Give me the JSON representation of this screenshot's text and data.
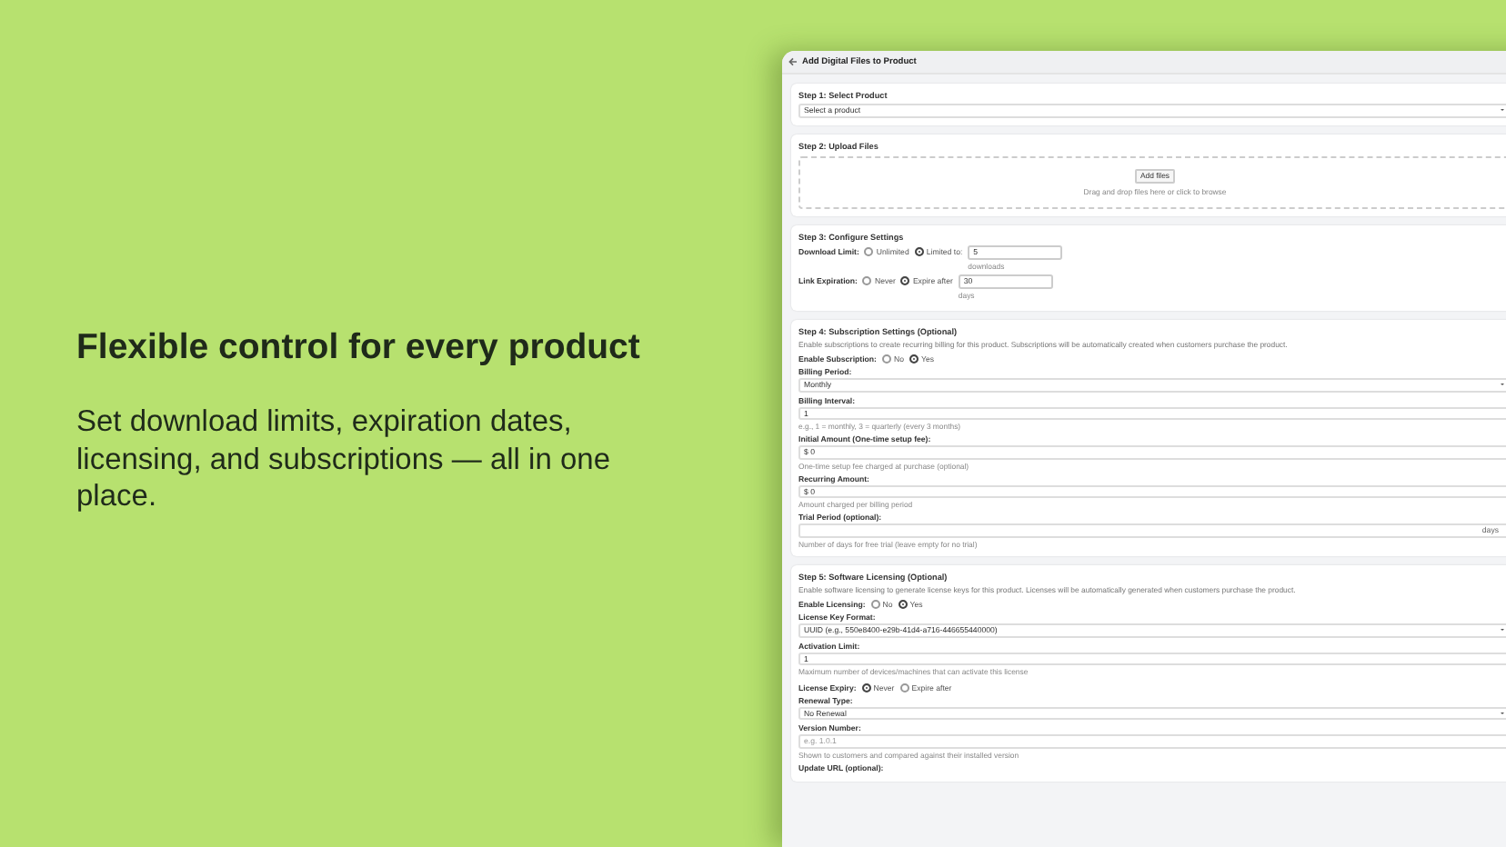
{
  "headline": "Flexible control for every product",
  "subtext": "Set download limits, expiration dates, licensing, and subscriptions — all in one place.",
  "window": {
    "title": "Add Digital Files to Product"
  },
  "steps": [
    {
      "title": "Step 1: Select Product",
      "fields": [
        {
          "kind": "select",
          "value": "Select a product"
        }
      ]
    },
    {
      "title": "Step 2: Upload Files",
      "fields": [
        {
          "kind": "dropzone",
          "button": "Add files",
          "hint": "Drag and drop files here or click to browse"
        }
      ]
    },
    {
      "title": "Step 3: Configure Settings",
      "fields": [
        {
          "kind": "radio",
          "label": "Download Limit:",
          "options": [
            {
              "label": "Unlimited",
              "selected": false
            },
            {
              "label": "Limited to:",
              "selected": true
            }
          ],
          "input": {
            "value": "5",
            "unit": "downloads"
          }
        },
        {
          "kind": "radio",
          "label": "Link Expiration:",
          "options": [
            {
              "label": "Never",
              "selected": false
            },
            {
              "label": "Expire after",
              "selected": true
            }
          ],
          "input": {
            "value": "30",
            "unit": "days"
          }
        }
      ]
    },
    {
      "title": "Step 4: Subscription Settings (Optional)",
      "description": "Enable subscriptions to create recurring billing for this product. Subscriptions will be automatically created when customers purchase the product.",
      "fields": [
        {
          "kind": "radio",
          "label": "Enable Subscription:",
          "options": [
            {
              "label": "No",
              "selected": false
            },
            {
              "label": "Yes",
              "selected": true
            }
          ]
        },
        {
          "kind": "select",
          "label": "Billing Period:",
          "value": "Monthly"
        },
        {
          "kind": "input",
          "label": "Billing Interval:",
          "value": "1",
          "hint": "e.g., 1 = monthly, 3 = quarterly (every 3 months)"
        },
        {
          "kind": "input",
          "label": "Initial Amount (One-time setup fee):",
          "value": "$ 0",
          "hint": "One-time setup fee charged at purchase (optional)"
        },
        {
          "kind": "input",
          "label": "Recurring Amount:",
          "value": "$ 0",
          "hint": "Amount charged per billing period"
        },
        {
          "kind": "input",
          "label": "Trial Period (optional):",
          "suffix": "days",
          "hint": "Number of days for free trial (leave empty for no trial)"
        }
      ]
    },
    {
      "title": "Step 5: Software Licensing (Optional)",
      "description": "Enable software licensing to generate license keys for this product. Licenses will be automatically generated when customers purchase the product.",
      "fields": [
        {
          "kind": "radio",
          "label": "Enable Licensing:",
          "options": [
            {
              "label": "No",
              "selected": false
            },
            {
              "label": "Yes",
              "selected": true
            }
          ]
        },
        {
          "kind": "select",
          "label": "License Key Format:",
          "value": "UUID (e.g., 550e8400-e29b-41d4-a716-446655440000)"
        },
        {
          "kind": "input",
          "label": "Activation Limit:",
          "value": "1",
          "hint": "Maximum number of devices/machines that can activate this license"
        },
        {
          "kind": "radio",
          "label": "License Expiry:",
          "options": [
            {
              "label": "Never",
              "selected": true
            },
            {
              "label": "Expire after",
              "selected": false
            }
          ]
        },
        {
          "kind": "select",
          "label": "Renewal Type:",
          "value": "No Renewal"
        },
        {
          "kind": "input",
          "label": "Version Number:",
          "placeholder": "e.g. 1.0.1",
          "hint": "Shown to customers and compared against their installed version"
        },
        {
          "kind": "label",
          "label": "Update URL (optional):"
        }
      ]
    }
  ]
}
